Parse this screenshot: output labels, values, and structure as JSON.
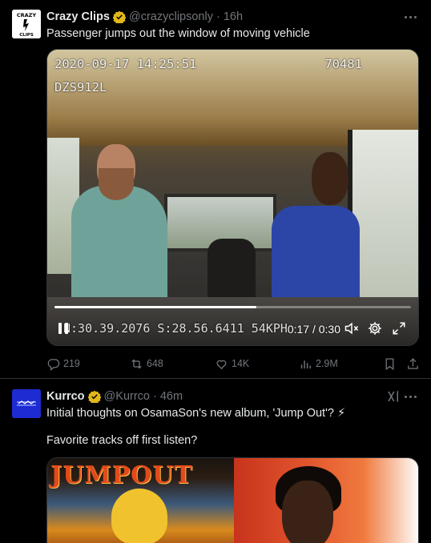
{
  "tweets": [
    {
      "author_name": "Crazy Clips",
      "handle": "@crazyclipsonly",
      "separator": "·",
      "time": "16h",
      "text": "Passenger jumps out the window of moving vehicle",
      "avatar_text_top": "CRAZY",
      "avatar_text_bottom": "CLIPS",
      "video": {
        "timestamp": "2020-09-17 14:25:51",
        "counter": "70481",
        "plate": "DZS912L",
        "gps": "N:30.39.2076 S:28.56.6411 54KPH",
        "time_current": "0:17",
        "time_sep": " / ",
        "time_total": "0:30",
        "progress": 0.567
      },
      "stats": {
        "replies": "219",
        "retweets": "648",
        "likes": "14K",
        "views": "2.9M"
      }
    },
    {
      "author_name": "Kurrco",
      "handle": "@Kurrco",
      "separator": "·",
      "time": "46m",
      "text_line1": "Initial thoughts on OsamaSon's new album, 'Jump Out'? ⚡",
      "text_line2": "Favorite tracks off first listen?",
      "album_title_text": "JUMPOUT"
    }
  ],
  "colors": {
    "background": "#000000",
    "text": "#e7e9ea",
    "muted": "#71767b",
    "border": "#2f3336",
    "verified_gold": "#e2b719"
  }
}
